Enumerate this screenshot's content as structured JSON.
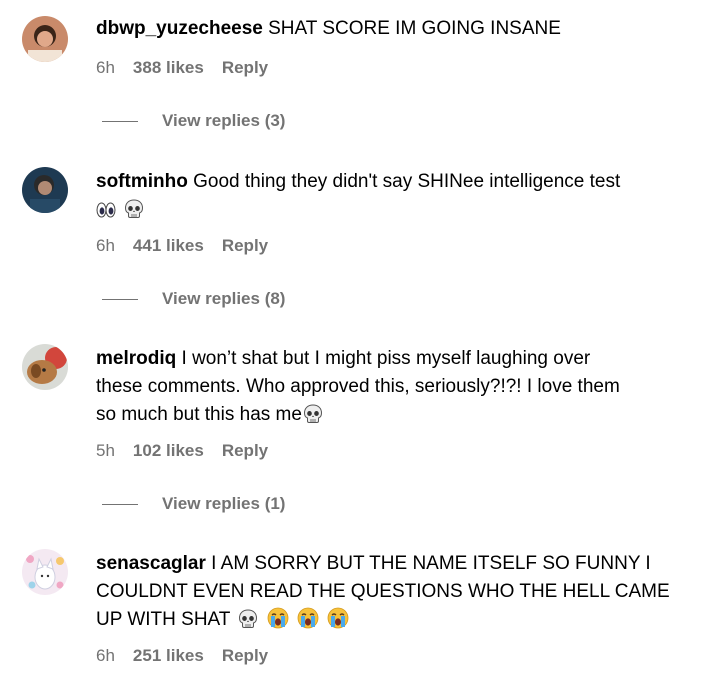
{
  "comments": [
    {
      "username": "dbwp_yuzecheese",
      "text": "SHAT SCORE IM GOING INSANE",
      "time": "6h",
      "likes": "388 likes",
      "reply": "Reply",
      "view_replies": "View replies (3)"
    },
    {
      "username": "softminho",
      "text": "Good thing they didn't say SHINee intelligence test",
      "emojis": [
        "eyes",
        "skull"
      ],
      "time": "6h",
      "likes": "441 likes",
      "reply": "Reply",
      "view_replies": "View replies (8)"
    },
    {
      "username": "melrodiq",
      "text_line1": "I won’t shat but I might piss myself laughing over",
      "text_line2": "these comments. Who approved this, seriously?!?! I love them",
      "text_line3": "so much but this has me",
      "emojis": [
        "skull"
      ],
      "time": "5h",
      "likes": "102 likes",
      "reply": "Reply",
      "view_replies": "View replies (1)"
    },
    {
      "username": "senascaglar",
      "text_line1": "I AM SORRY BUT THE NAME ITSELF SO FUNNY I",
      "text_line2": "COULDNT EVEN READ THE QUESTIONS WHO THE HELL CAME",
      "text_line3": "UP WITH SHAT",
      "emojis": [
        "skull",
        "loudly-crying-face",
        "loudly-crying-face",
        "loudly-crying-face"
      ],
      "time": "6h",
      "likes": "251 likes",
      "reply": "Reply"
    }
  ]
}
